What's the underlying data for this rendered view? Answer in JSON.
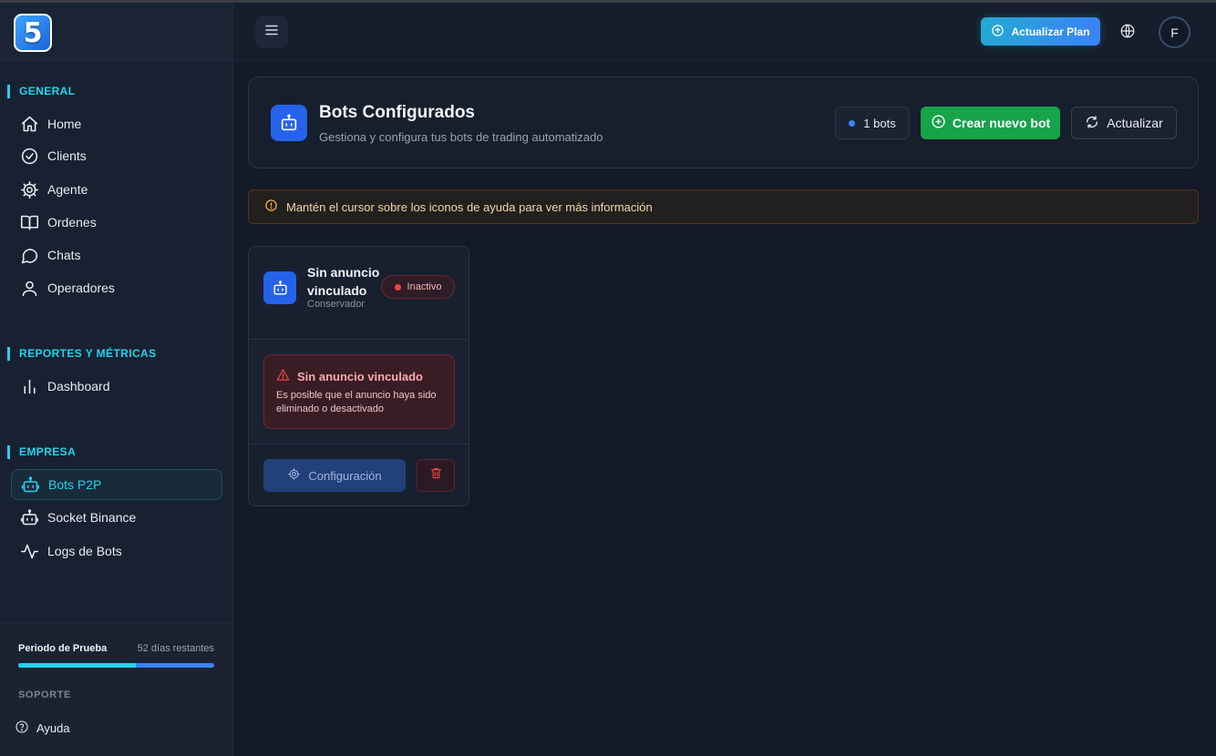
{
  "sidebar": {
    "logo_text": "5",
    "sections": [
      {
        "title": "GENERAL",
        "items": [
          {
            "label": "Home",
            "icon": "home-icon"
          },
          {
            "label": "Clients",
            "icon": "check-circle-icon"
          },
          {
            "label": "Agente",
            "icon": "gear-icon"
          },
          {
            "label": "Ordenes",
            "icon": "book-icon"
          },
          {
            "label": "Chats",
            "icon": "chat-icon"
          },
          {
            "label": "Operadores",
            "icon": "user-icon"
          }
        ]
      },
      {
        "title": "REPORTES Y MÉTRICAS",
        "items": [
          {
            "label": "Dashboard",
            "icon": "bar-chart-icon"
          }
        ]
      },
      {
        "title": "EMPRESA",
        "items": [
          {
            "label": "Bots P2P",
            "icon": "bot-icon",
            "active": true
          },
          {
            "label": "Socket Binance",
            "icon": "bot-icon"
          },
          {
            "label": "Logs de Bots",
            "icon": "activity-icon"
          }
        ]
      }
    ],
    "trial": {
      "label": "Periodo de Prueba",
      "days": "52 días restantes",
      "progress": 0.6
    },
    "support_title": "SOPORTE",
    "help_label": "Ayuda"
  },
  "topbar": {
    "upgrade_label": "Actualizar Plan",
    "avatar_initial": "F"
  },
  "header": {
    "title": "Bots Configurados",
    "subtitle": "Gestiona y configura tus bots de trading automatizado",
    "count_label": "1 bots",
    "create_label": "Crear nuevo bot",
    "refresh_label": "Actualizar"
  },
  "info_banner": "Mantén el cursor sobre los iconos de ayuda para ver más información",
  "bots": [
    {
      "name": "Sin anuncio vinculado",
      "strategy": "Conservador",
      "status": "Inactivo",
      "alert_title": "Sin anuncio vinculado",
      "alert_text": "Es posible que el anuncio haya sido eliminado o desactivado",
      "config_label": "Configuración"
    }
  ],
  "colors": {
    "accent": "#22d3ee",
    "primary": "#2563eb",
    "success": "#16a34a",
    "danger": "#ef4444",
    "warning": "#f0b341"
  }
}
